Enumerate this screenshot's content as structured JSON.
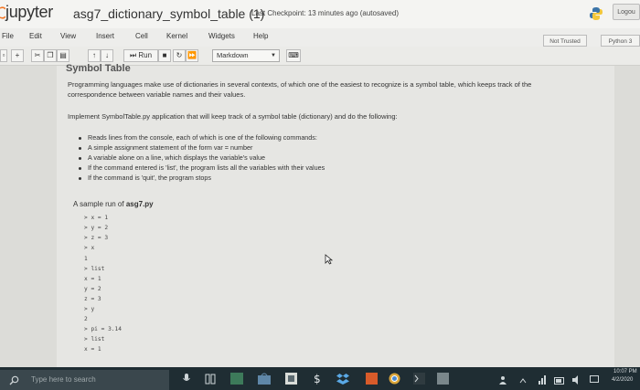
{
  "header": {
    "logo": "jupyter",
    "notebook_title": "asg7_dictionary_symbol_table (1)",
    "checkpoint": "Last Checkpoint: 13 minutes ago (autosaved)",
    "logout": "Logou"
  },
  "menu": {
    "items": [
      "File",
      "Edit",
      "View",
      "Insert",
      "Cell",
      "Kernel",
      "Widgets",
      "Help"
    ]
  },
  "status": {
    "trust": "Not Trusted",
    "kernel": "Python 3"
  },
  "toolbar": {
    "run_label": "Run",
    "cell_type": "Markdown"
  },
  "content": {
    "cut_heading": "Symbol Table",
    "intro_line1": "Programming languages make use of dictionaries in several contexts, of which one of the easiest to recognize is a symbol table, which keeps track of the",
    "intro_line2": "correspondence between variable names and their values.",
    "task": "Implement SymbolTable.py application that will keep track of a symbol table (dictionary) and do the following:",
    "bullets": [
      "Reads lines from the console, each of which is one of the following commands:",
      "A simple assignment statement of the form var = number",
      "A variable alone on a line, which displays the variable's value",
      "If the command entered is 'list', the program lists all the variables with their values",
      "If the command is 'quit', the program stops"
    ],
    "sample_prefix": "A sample run of",
    "sample_file": "asg7.py",
    "code_lines": [
      "> x = 1",
      "> y = 2",
      "> z = 3",
      "> x",
      "1",
      "> list",
      "x = 1",
      "y = 2",
      "z = 3",
      "> y",
      "2",
      "> pi = 3.14",
      "> list",
      "x = 1"
    ]
  },
  "taskbar": {
    "search_placeholder": "Type here to search",
    "time": "10:07 PM",
    "date": "4/2/2020"
  },
  "colors": {
    "jupyter_orange": "#f37726",
    "taskbar_bg": "#1f2d33"
  }
}
